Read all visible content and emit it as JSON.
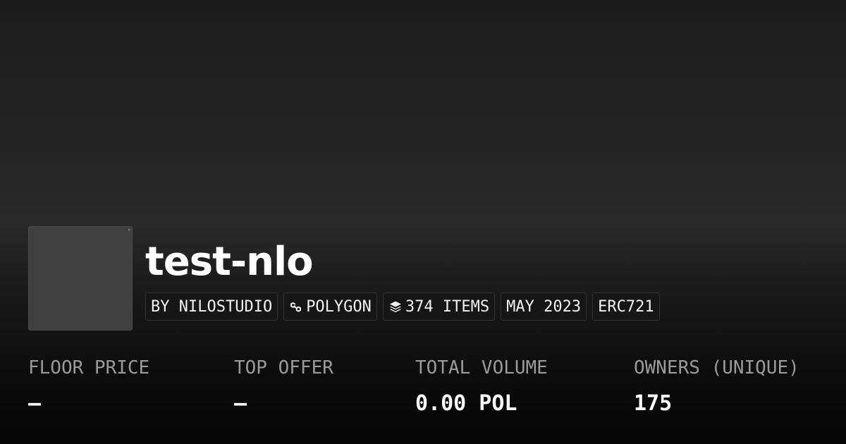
{
  "collection": {
    "name": "test-nlo"
  },
  "tags": [
    {
      "label": "BY NILOSTUDIO",
      "icon": ""
    },
    {
      "label": "POLYGON",
      "icon": "polygon-chain-icon"
    },
    {
      "label": "374 ITEMS",
      "icon": "layers-icon"
    },
    {
      "label": "MAY 2023",
      "icon": ""
    },
    {
      "label": "ERC721",
      "icon": ""
    }
  ],
  "stats": [
    {
      "label": "FLOOR PRICE",
      "value": "—"
    },
    {
      "label": "TOP OFFER",
      "value": "—"
    },
    {
      "label": "TOTAL VOLUME",
      "value": "0.00 POL"
    },
    {
      "label": "OWNERS (UNIQUE)",
      "value": "175"
    }
  ],
  "colors": {
    "background_top": "#1c1c1c",
    "background_bottom": "#050505",
    "avatar_placeholder": "#404040",
    "label_gray": "#9a9a9a",
    "text_white": "#ffffff"
  }
}
